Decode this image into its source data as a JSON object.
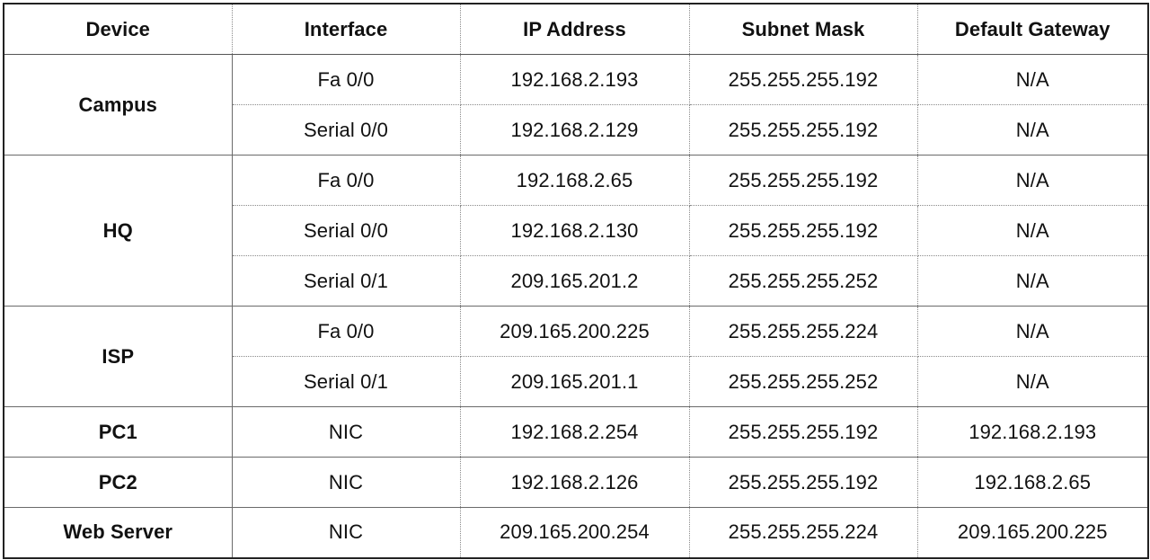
{
  "headers": [
    "Device",
    "Interface",
    "IP Address",
    "Subnet Mask",
    "Default Gateway"
  ],
  "rows": [
    {
      "device": "Campus",
      "interface": "Fa 0/0",
      "ip": "192.168.2.193",
      "mask": "255.255.255.192",
      "gateway": "N/A"
    },
    {
      "device": "",
      "interface": "Serial 0/0",
      "ip": "192.168.2.129",
      "mask": "255.255.255.192",
      "gateway": "N/A"
    },
    {
      "device": "HQ",
      "interface": "Fa 0/0",
      "ip": "192.168.2.65",
      "mask": "255.255.255.192",
      "gateway": "N/A"
    },
    {
      "device": "",
      "interface": "Serial 0/0",
      "ip": "192.168.2.130",
      "mask": "255.255.255.192",
      "gateway": "N/A"
    },
    {
      "device": "",
      "interface": "Serial 0/1",
      "ip": "209.165.201.2",
      "mask": "255.255.255.252",
      "gateway": "N/A"
    },
    {
      "device": "ISP",
      "interface": "Fa 0/0",
      "ip": "209.165.200.225",
      "mask": "255.255.255.224",
      "gateway": "N/A"
    },
    {
      "device": "",
      "interface": "Serial 0/1",
      "ip": "209.165.201.1",
      "mask": "255.255.255.252",
      "gateway": "N/A"
    },
    {
      "device": "PC1",
      "interface": "NIC",
      "ip": "192.168.2.254",
      "mask": "255.255.255.192",
      "gateway": "192.168.2.193"
    },
    {
      "device": "PC2",
      "interface": "NIC",
      "ip": "192.168.2.126",
      "mask": "255.255.255.192",
      "gateway": "192.168.2.65"
    },
    {
      "device": "Web Server",
      "interface": "NIC",
      "ip": "209.165.200.254",
      "mask": "255.255.255.224",
      "gateway": "209.165.200.225"
    }
  ]
}
